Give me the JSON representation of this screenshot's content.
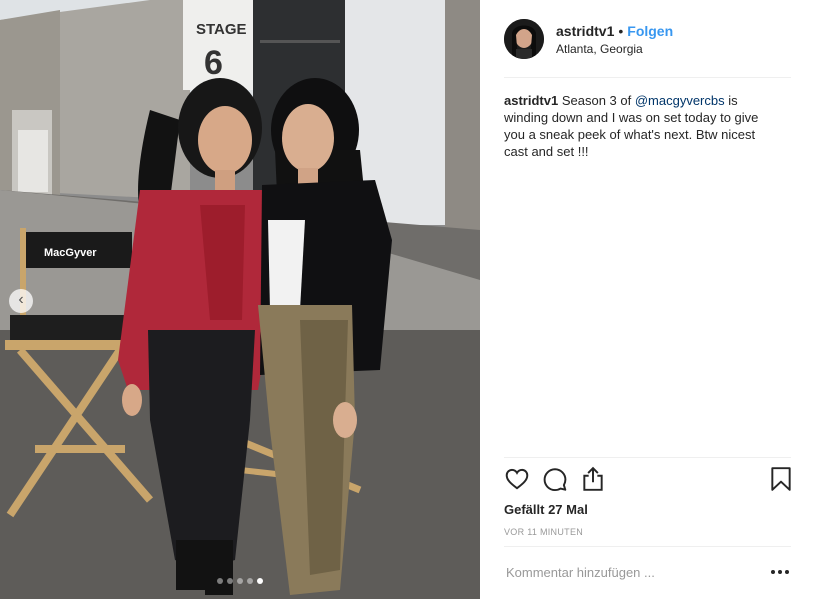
{
  "post": {
    "username": "astridtv1",
    "separator": "•",
    "follow_label": "Folgen",
    "location": "Atlanta, Georgia",
    "caption": {
      "username": "astridtv1",
      "text_before": "Season 3 of",
      "mention": "@macgyvercbs",
      "text_after": "is winding down and I was on set today to give you a sneak peek of what's next. Btw nicest cast and set !!!"
    },
    "likes_label": "Gefällt 27 Mal",
    "timestamp": "VOR 11 MINUTEN",
    "comment_placeholder": "Kommentar hinzufügen ...",
    "more_label": "•••"
  },
  "photo": {
    "stage_sign_line1": "STAGE",
    "stage_sign_line2": "6",
    "chair_label": "MacGyver",
    "prev_arrow": "‹",
    "carousel": {
      "count": 5,
      "active_index": 4
    }
  },
  "icons": [
    "heart-icon",
    "comment-icon",
    "share-icon",
    "bookmark-icon",
    "chevron-left-icon",
    "more-icon"
  ],
  "colors": {
    "link_blue": "#3897f0",
    "mention_blue": "#003569",
    "divider": "#efefef",
    "muted": "#999999"
  }
}
